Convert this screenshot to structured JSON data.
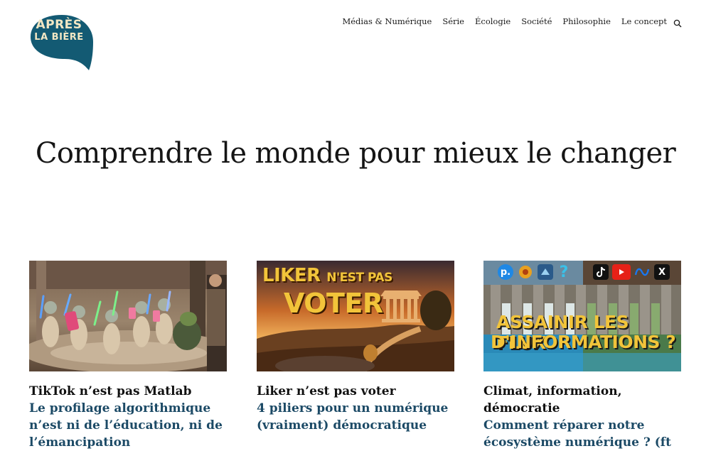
{
  "header": {
    "logo": {
      "line1": "APRÈS",
      "line2": "LA BIÈRE"
    },
    "nav": [
      {
        "label": "Médias & Numérique"
      },
      {
        "label": "Série"
      },
      {
        "label": "Écologie"
      },
      {
        "label": "Société"
      },
      {
        "label": "Philosophie"
      },
      {
        "label": "Le concept"
      }
    ],
    "search_icon": "search-icon"
  },
  "hero": {
    "title": "Comprendre le monde pour mieux le changer"
  },
  "articles": [
    {
      "title": "TikTok n’est pas Matlab",
      "subtitle": "Le profilage algorithmique n’est ni de l’éducation, ni de l’émancipation",
      "image": "younglings-with-phones-illustration"
    },
    {
      "title": "Liker n’est pas voter",
      "subtitle": "4 piliers pour un numérique (vraiment) démocratique",
      "image": "greek-temple-sunset-illustration",
      "image_text": {
        "line1a": "LIKER",
        "line1b": "N'EST PAS",
        "line2": "VOTER"
      }
    },
    {
      "title": "Climat, information, démocratie",
      "subtitle": "Comment réparer notre écosystème numérique ? (ft",
      "image": "dam-social-networks-illustration",
      "image_text": {
        "line1": "ASSAINIR LES FLUX",
        "line2": "D'INFORMATIONS ?"
      },
      "image_icons": [
        "p.",
        "?",
        "YouTube",
        "Meta",
        "X",
        "TikTok"
      ]
    }
  ],
  "colors": {
    "brand_teal": "#135a73",
    "logo_text": "#f3e7c4",
    "subtitle": "#1c4a66",
    "thumb_text": "#f2c43a"
  }
}
